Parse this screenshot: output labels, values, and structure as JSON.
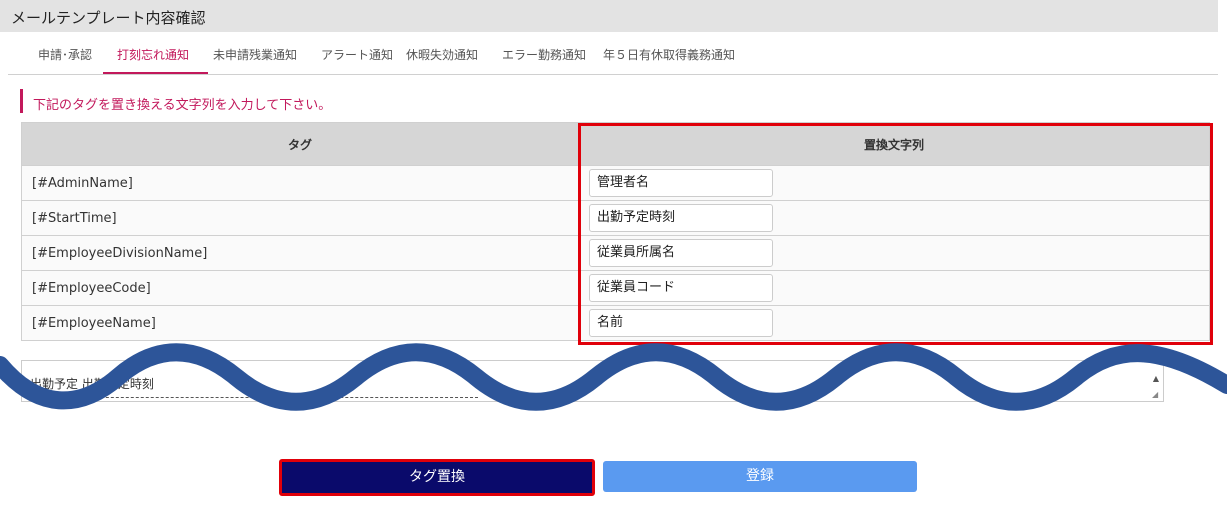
{
  "page": {
    "title": "メールテンプレート内容確認"
  },
  "tabs": [
    {
      "label": "申請･承認"
    },
    {
      "label": "打刻忘れ通知"
    },
    {
      "label": "未申請残業通知"
    },
    {
      "label": "アラート通知"
    },
    {
      "label": "休暇失効通知"
    },
    {
      "label": "エラー勤務通知"
    },
    {
      "label": "年５日有休取得義務通知"
    }
  ],
  "active_tab": "打刻忘れ通知",
  "instruction": "下記のタグを置き換える文字列を入力して下さい。",
  "table": {
    "headers": {
      "tag": "タグ",
      "replacement": "置換文字列"
    },
    "rows": [
      {
        "tag": "[#AdminName]",
        "value": "管理者名"
      },
      {
        "tag": "[#StartTime]",
        "value": "出勤予定時刻"
      },
      {
        "tag": "[#EmployeeDivisionName]",
        "value": "従業員所属名"
      },
      {
        "tag": "[#EmployeeCode]",
        "value": "従業員コード"
      },
      {
        "tag": "[#EmployeeName]",
        "value": "名前"
      }
    ]
  },
  "body_preview": {
    "text": "出勤予定 出勤予定時刻"
  },
  "buttons": {
    "replace": "タグ置換",
    "register": "登録"
  },
  "colors": {
    "accent": "#c2185b",
    "highlight_border": "#e0000a",
    "replace_button": "#0a0a6b",
    "register_button": "#5a9af0",
    "wave": "#2d5599"
  }
}
